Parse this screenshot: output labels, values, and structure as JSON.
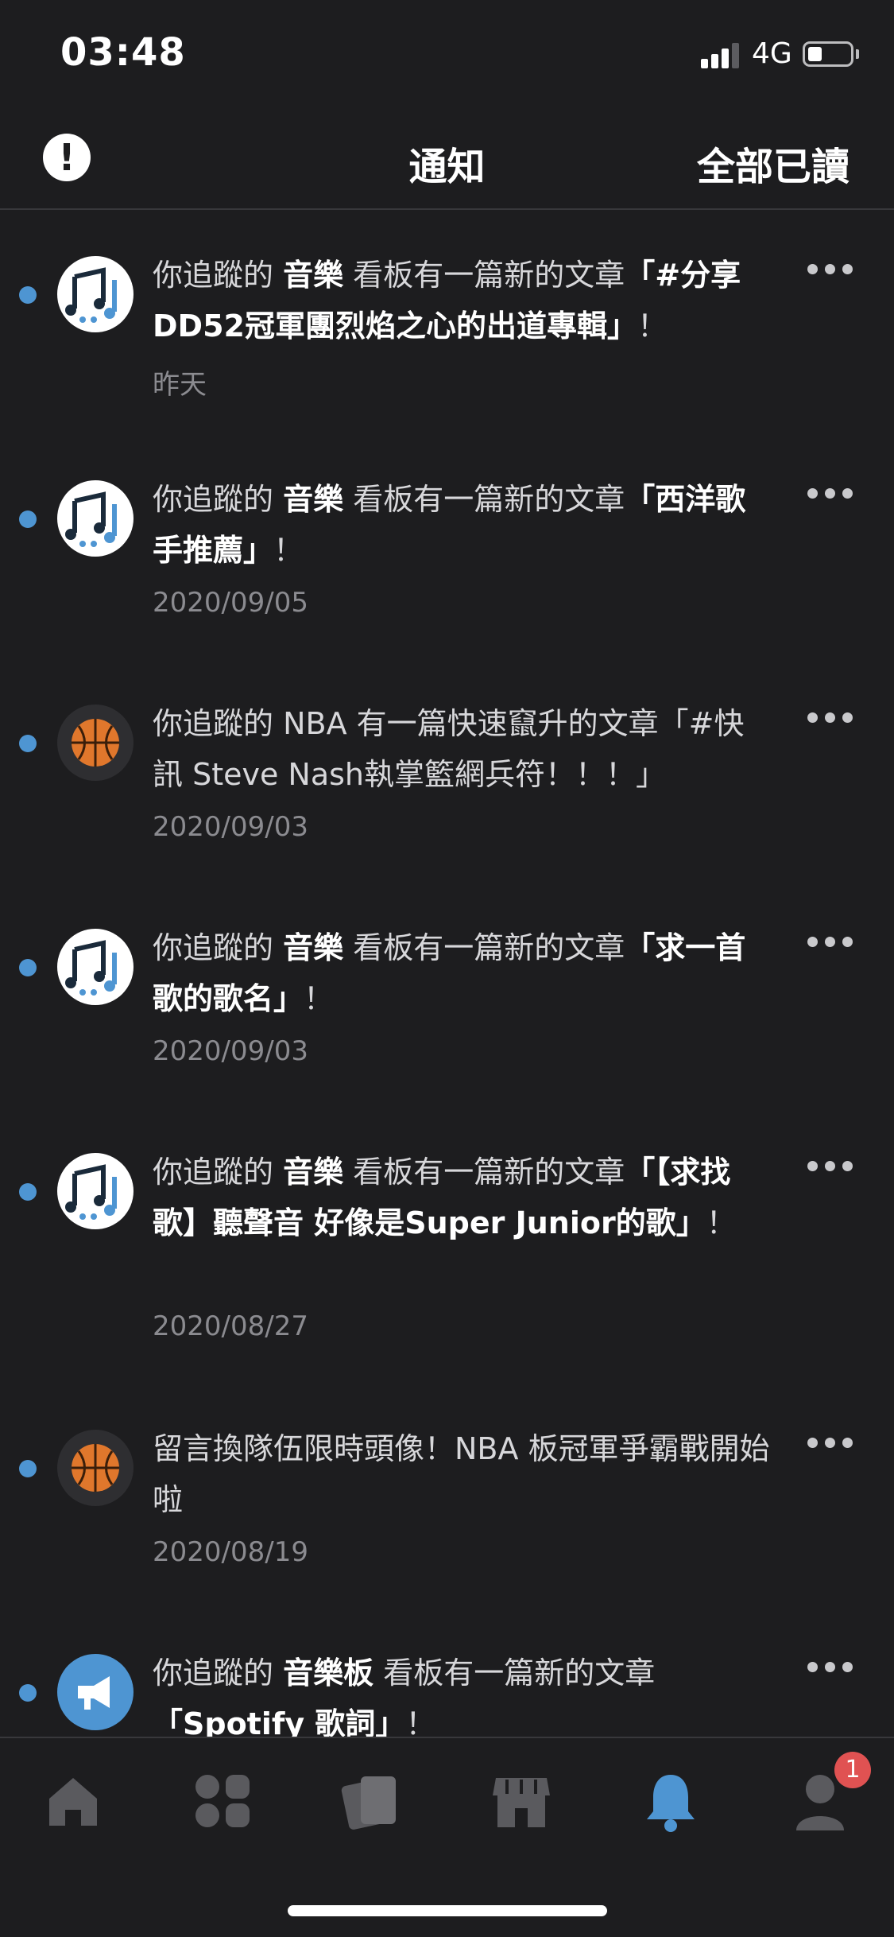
{
  "status_bar": {
    "time": "03:48",
    "network": "4G"
  },
  "header": {
    "title": "通知",
    "mark_all_read": "全部已讀"
  },
  "notifications": [
    {
      "prefix": "你追蹤的",
      "board": "音樂",
      "middle": "看板有一篇新的文章",
      "article": "「#分享 DD52冠軍團烈焰之心的出道專輯」",
      "suffix": "！",
      "date": "昨天",
      "avatar": "music-note-icon",
      "unread": true
    },
    {
      "prefix": "你追蹤的",
      "board": "音樂",
      "middle": "看板有一篇新的文章",
      "article": "「西洋歌手推薦」",
      "suffix": "！",
      "date": "2020/09/05",
      "avatar": "music-note-icon",
      "unread": true
    },
    {
      "prefix": "你追蹤的 NBA 有一篇快速竄升的文章「#快訊 Steve Nash執掌籃網兵符！！！」",
      "date": "2020/09/03",
      "avatar": "basketball-icon",
      "unread": true
    },
    {
      "prefix": "你追蹤的",
      "board": "音樂",
      "middle": "看板有一篇新的文章",
      "article": "「求一首歌的歌名」",
      "suffix": "！",
      "date": "2020/09/03",
      "avatar": "music-note-icon",
      "unread": true
    },
    {
      "prefix": "你追蹤的",
      "board": "音樂",
      "middle": "看板有一篇新的文章",
      "article": "「【求找歌】聽聲音 好像是Super Junior的歌」",
      "suffix": "！",
      "date": "2020/08/27",
      "avatar": "music-note-icon",
      "unread": true
    },
    {
      "prefix": "留言換隊伍限時頭像！NBA 板冠軍爭霸戰開始啦",
      "date": "2020/08/19",
      "avatar": "basketball-icon",
      "unread": true
    },
    {
      "prefix": "你追蹤的",
      "board": "音樂板",
      "middle": "看板有一篇新的文章",
      "article": "「Spotify 歌詞」",
      "suffix": "！",
      "avatar": "megaphone-icon",
      "unread": true
    }
  ],
  "tabbar": {
    "items": [
      "home-icon",
      "boards-icon",
      "cards-icon",
      "shop-icon",
      "bell-icon",
      "profile-icon"
    ],
    "active": "bell-icon",
    "profile_badge": "1",
    "active_color": "#4e95d2"
  }
}
